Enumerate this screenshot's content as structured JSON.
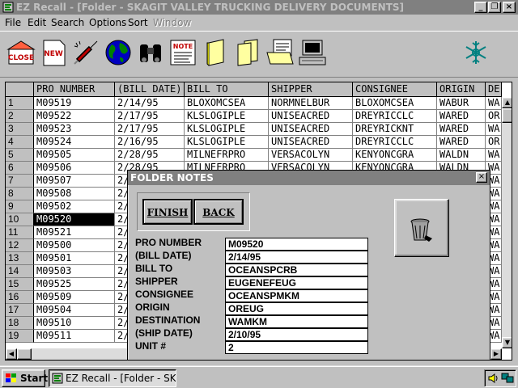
{
  "window": {
    "title": "EZ Recall - [Folder - SKAGIT VALLEY TRUCKING DELIVERY DOCUMENTS]",
    "controls": {
      "minimize": "_",
      "restore": "❐",
      "close": "×"
    }
  },
  "menu": {
    "items": [
      "File",
      "Edit",
      "Search",
      "Options",
      "Sort"
    ],
    "disabled_item": "Window"
  },
  "toolbar": {
    "close_label": "CLOSE",
    "new_label": "NEW",
    "note_label": "NOTE",
    "icons": [
      "close-icon",
      "new-document-icon",
      "syringe-icon",
      "globe-icon",
      "binoculars-icon",
      "note-icon",
      "folder-icon",
      "folders-icon",
      "file-cabinet-icon",
      "computer-icon",
      "snowflake-icon"
    ]
  },
  "grid": {
    "columns": [
      "PRO NUMBER",
      "(BILL DATE)",
      "BILL TO",
      "SHIPPER",
      "CONSIGNEE",
      "ORIGIN",
      "DE"
    ],
    "selected_row": 10,
    "rows": [
      {
        "n": "1",
        "pro": "M09519",
        "date": "2/14/95",
        "billto": "BLOXOMCSEA",
        "shipper": "NORMNELBUR",
        "consignee": "BLOXOMCSEA",
        "origin": "WABUR",
        "dest": "WA"
      },
      {
        "n": "2",
        "pro": "M09522",
        "date": "2/17/95",
        "billto": "KLSLOGIPLE",
        "shipper": "UNISEACRED",
        "consignee": "DREYRICCLC",
        "origin": "WARED",
        "dest": "OR"
      },
      {
        "n": "3",
        "pro": "M09523",
        "date": "2/17/95",
        "billto": "KLSLOGIPLE",
        "shipper": "UNISEACRED",
        "consignee": "DREYRICKNT",
        "origin": "WARED",
        "dest": "WA"
      },
      {
        "n": "4",
        "pro": "M09524",
        "date": "2/16/95",
        "billto": "KLSLOGIPLE",
        "shipper": "UNISEACRED",
        "consignee": "DREYRICCLC",
        "origin": "WARED",
        "dest": "OR"
      },
      {
        "n": "5",
        "pro": "M09505",
        "date": "2/28/95",
        "billto": "MILNEFRPRO",
        "shipper": "VERSACOLYN",
        "consignee": "KENYONCGRA",
        "origin": "WALDN",
        "dest": "WA"
      },
      {
        "n": "6",
        "pro": "M09506",
        "date": "2/28/95",
        "billto": "MILNEFRPRO",
        "shipper": "VERSACOLYN",
        "consignee": "KENYONCGRA",
        "origin": "WALDN",
        "dest": "WA"
      },
      {
        "n": "7",
        "pro": "M09507",
        "date": "2/",
        "billto": "",
        "shipper": "",
        "consignee": "",
        "origin": "",
        "dest": "WA"
      },
      {
        "n": "8",
        "pro": "M09508",
        "date": "2/",
        "billto": "",
        "shipper": "",
        "consignee": "",
        "origin": "",
        "dest": "WA"
      },
      {
        "n": "9",
        "pro": "M09502",
        "date": "2/",
        "billto": "",
        "shipper": "",
        "consignee": "",
        "origin": "",
        "dest": "WA"
      },
      {
        "n": "10",
        "pro": "M09520",
        "date": "2/",
        "billto": "",
        "shipper": "",
        "consignee": "",
        "origin": "",
        "dest": "WA"
      },
      {
        "n": "11",
        "pro": "M09521",
        "date": "2/",
        "billto": "",
        "shipper": "",
        "consignee": "",
        "origin": "",
        "dest": "WA"
      },
      {
        "n": "12",
        "pro": "M09500",
        "date": "2/",
        "billto": "",
        "shipper": "",
        "consignee": "",
        "origin": "",
        "dest": "WA"
      },
      {
        "n": "13",
        "pro": "M09501",
        "date": "2/",
        "billto": "",
        "shipper": "",
        "consignee": "",
        "origin": "",
        "dest": "WA"
      },
      {
        "n": "14",
        "pro": "M09503",
        "date": "2/",
        "billto": "",
        "shipper": "",
        "consignee": "",
        "origin": "",
        "dest": "WA"
      },
      {
        "n": "15",
        "pro": "M09525",
        "date": "2/",
        "billto": "",
        "shipper": "",
        "consignee": "",
        "origin": "",
        "dest": "WA"
      },
      {
        "n": "16",
        "pro": "M09509",
        "date": "2/",
        "billto": "",
        "shipper": "",
        "consignee": "",
        "origin": "",
        "dest": "WA"
      },
      {
        "n": "17",
        "pro": "M09504",
        "date": "2/",
        "billto": "",
        "shipper": "",
        "consignee": "",
        "origin": "",
        "dest": "WA"
      },
      {
        "n": "18",
        "pro": "M09510",
        "date": "2/",
        "billto": "",
        "shipper": "",
        "consignee": "",
        "origin": "",
        "dest": "WA"
      },
      {
        "n": "19",
        "pro": "M09511",
        "date": "2/",
        "billto": "",
        "shipper": "",
        "consignee": "",
        "origin": "",
        "dest": "WA"
      }
    ]
  },
  "notes": {
    "title": "FOLDER NOTES",
    "finish_label": "FINISH",
    "back_label": "BACK",
    "fields": [
      {
        "label": "PRO NUMBER",
        "value": "M09520"
      },
      {
        "label": "(BILL DATE)",
        "value": "2/14/95"
      },
      {
        "label": "BILL TO",
        "value": "OCEANSPCRB"
      },
      {
        "label": "SHIPPER",
        "value": "EUGENEFEUG"
      },
      {
        "label": "CONSIGNEE",
        "value": "OCEANSPMKM"
      },
      {
        "label": "ORIGIN",
        "value": "OREUG"
      },
      {
        "label": "DESTINATION",
        "value": "WAMKM"
      },
      {
        "label": "(SHIP DATE)",
        "value": "2/10/95"
      },
      {
        "label": "UNIT #",
        "value": "2"
      }
    ]
  },
  "taskbar": {
    "start_label": "Start",
    "task_label": "EZ Recall - [Folder - SKAG..."
  }
}
